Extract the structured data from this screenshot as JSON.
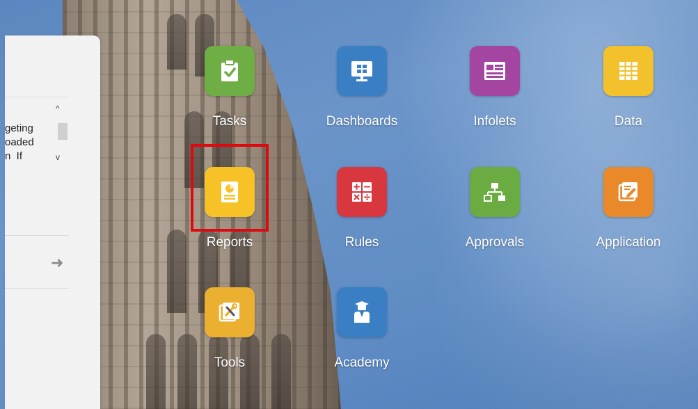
{
  "left_panel": {
    "text_lines": [
      "geting",
      "oaded",
      "n  If"
    ],
    "scroll_up_glyph": "^",
    "scroll_down_glyph": "v",
    "next_arrow": "➜"
  },
  "tiles": [
    {
      "label": "Tasks",
      "icon": "clipboard-check-icon",
      "color": "#6fae45"
    },
    {
      "label": "Dashboards",
      "icon": "monitor-dashboard-icon",
      "color": "#3a7fc4"
    },
    {
      "label": "Infolets",
      "icon": "infolet-card-icon",
      "color": "#a545a2"
    },
    {
      "label": "Data",
      "icon": "data-grid-icon",
      "color": "#f2c12c"
    },
    {
      "label": "Reports",
      "icon": "report-document-icon",
      "color": "#f6c228"
    },
    {
      "label": "Rules",
      "icon": "calculator-icon",
      "color": "#d9373f"
    },
    {
      "label": "Approvals",
      "icon": "hierarchy-icon",
      "color": "#6aab42"
    },
    {
      "label": "Application",
      "icon": "application-edit-icon",
      "color": "#e9892a"
    },
    {
      "label": "Tools",
      "icon": "tools-icon",
      "color": "#ebb030"
    },
    {
      "label": "Academy",
      "icon": "academy-graduate-icon",
      "color": "#3a7fc4"
    }
  ],
  "highlighted_tile": "Reports",
  "highlight_color": "#e0080f"
}
